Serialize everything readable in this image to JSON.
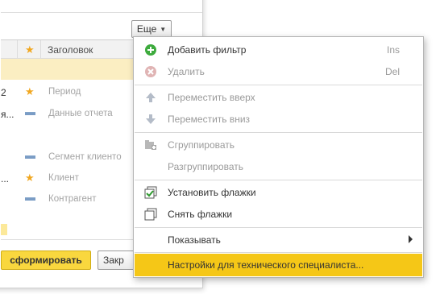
{
  "form": {
    "more_button_label": "Еще",
    "grid": {
      "header_title": "Заголовок",
      "rows": [
        {
          "num": "",
          "mark": "",
          "text": ""
        },
        {
          "num": "2",
          "mark": "star",
          "text": "Период"
        },
        {
          "num": "я...",
          "mark": "dash",
          "text": "Данные отчета"
        },
        {
          "num": "",
          "mark": "",
          "text": ""
        },
        {
          "num": "",
          "mark": "dash",
          "text": "Сегмент клиенто"
        },
        {
          "num": "...",
          "mark": "star",
          "text": "Клиент"
        },
        {
          "num": "",
          "mark": "dash",
          "text": "Контрагент"
        }
      ]
    },
    "generate_button_label": "сформировать",
    "close_button_label": "Закр"
  },
  "menu": {
    "items": [
      {
        "label": "Добавить фильтр",
        "shortcut": "Ins",
        "icon": "plus-circle-icon",
        "disabled": false
      },
      {
        "label": "Удалить",
        "shortcut": "Del",
        "icon": "x-circle-icon",
        "disabled": true
      },
      {
        "label": "Переместить вверх",
        "shortcut": "",
        "icon": "arrow-up-icon",
        "disabled": true
      },
      {
        "label": "Переместить вниз",
        "shortcut": "",
        "icon": "arrow-down-icon",
        "disabled": true
      },
      {
        "label": "Сгруппировать",
        "shortcut": "",
        "icon": "group-folder-icon",
        "disabled": true
      },
      {
        "label": "Разгруппировать",
        "shortcut": "",
        "icon": "",
        "disabled": true
      },
      {
        "label": "Установить флажки",
        "shortcut": "",
        "icon": "check-all-icon",
        "disabled": false
      },
      {
        "label": "Снять флажки",
        "shortcut": "",
        "icon": "uncheck-all-icon",
        "disabled": false
      },
      {
        "label": "Показывать",
        "shortcut": "",
        "icon": "",
        "disabled": false,
        "submenu": true
      },
      {
        "label": "Настройки для технического специалиста...",
        "shortcut": "",
        "icon": "",
        "disabled": false,
        "highlighted": true
      }
    ]
  },
  "colors": {
    "accent_yellow": "#f5c717",
    "selected_row": "#fbeec2",
    "star": "#f1a720",
    "dash": "#7a9cc5",
    "add_green": "#3eab3e"
  }
}
